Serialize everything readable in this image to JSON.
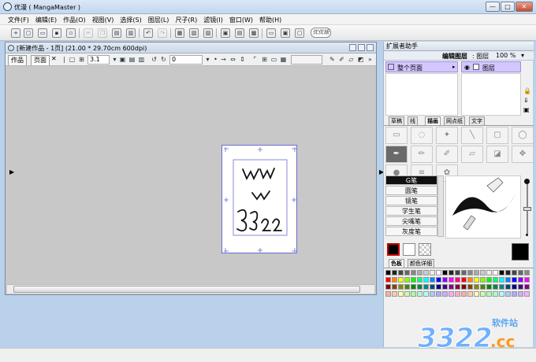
{
  "window": {
    "title": "优漫 ( MangaMaster )",
    "min_label": "—",
    "max_label": "□",
    "close_label": "✕"
  },
  "menu": [
    "文件(F)",
    "编辑(E)",
    "作品(O)",
    "视图(V)",
    "选择(S)",
    "图层(L)",
    "尺子(R)",
    "滤镜(I)",
    "窗口(W)",
    "帮助(H)"
  ],
  "toolbar": {
    "badge_label": "优优版"
  },
  "document": {
    "title": "[新建作品 - 1页] (21.00 * 29.70cm 600dpi)",
    "tabs": [
      "作品",
      "页面"
    ],
    "zoom": "3.1",
    "rotation": "0",
    "sketch_text": [
      "WW",
      "W",
      "3322"
    ]
  },
  "panel": {
    "title": "扩展者助手",
    "layer_header": {
      "edit_label": "编辑图层",
      "layer_label": ": 图层",
      "opacity": "100 %"
    },
    "pages_item": "整个页面",
    "layer_item": "图层",
    "tool_tabs": [
      "草稿",
      "线",
      "描画",
      "网点纸",
      "文字"
    ],
    "active_tool_tab": "描画",
    "pens": [
      "G笔",
      "圆笔",
      "镜笔",
      "学生笔",
      "尖嘴笔",
      "灰度笔"
    ],
    "selected_pen": "G笔",
    "color_tabs": [
      "色板",
      "颜色详细"
    ],
    "active_color_tab": "色板",
    "fg_color": "#000000",
    "bg_color": "#ffffff"
  },
  "colors": {
    "accent": "#d4c6ff",
    "page_border": "#6b6bd6",
    "titlebar": "#c3d7ee"
  },
  "watermark": {
    "text": "3322",
    "domain": ".cc",
    "label": "软件站"
  }
}
